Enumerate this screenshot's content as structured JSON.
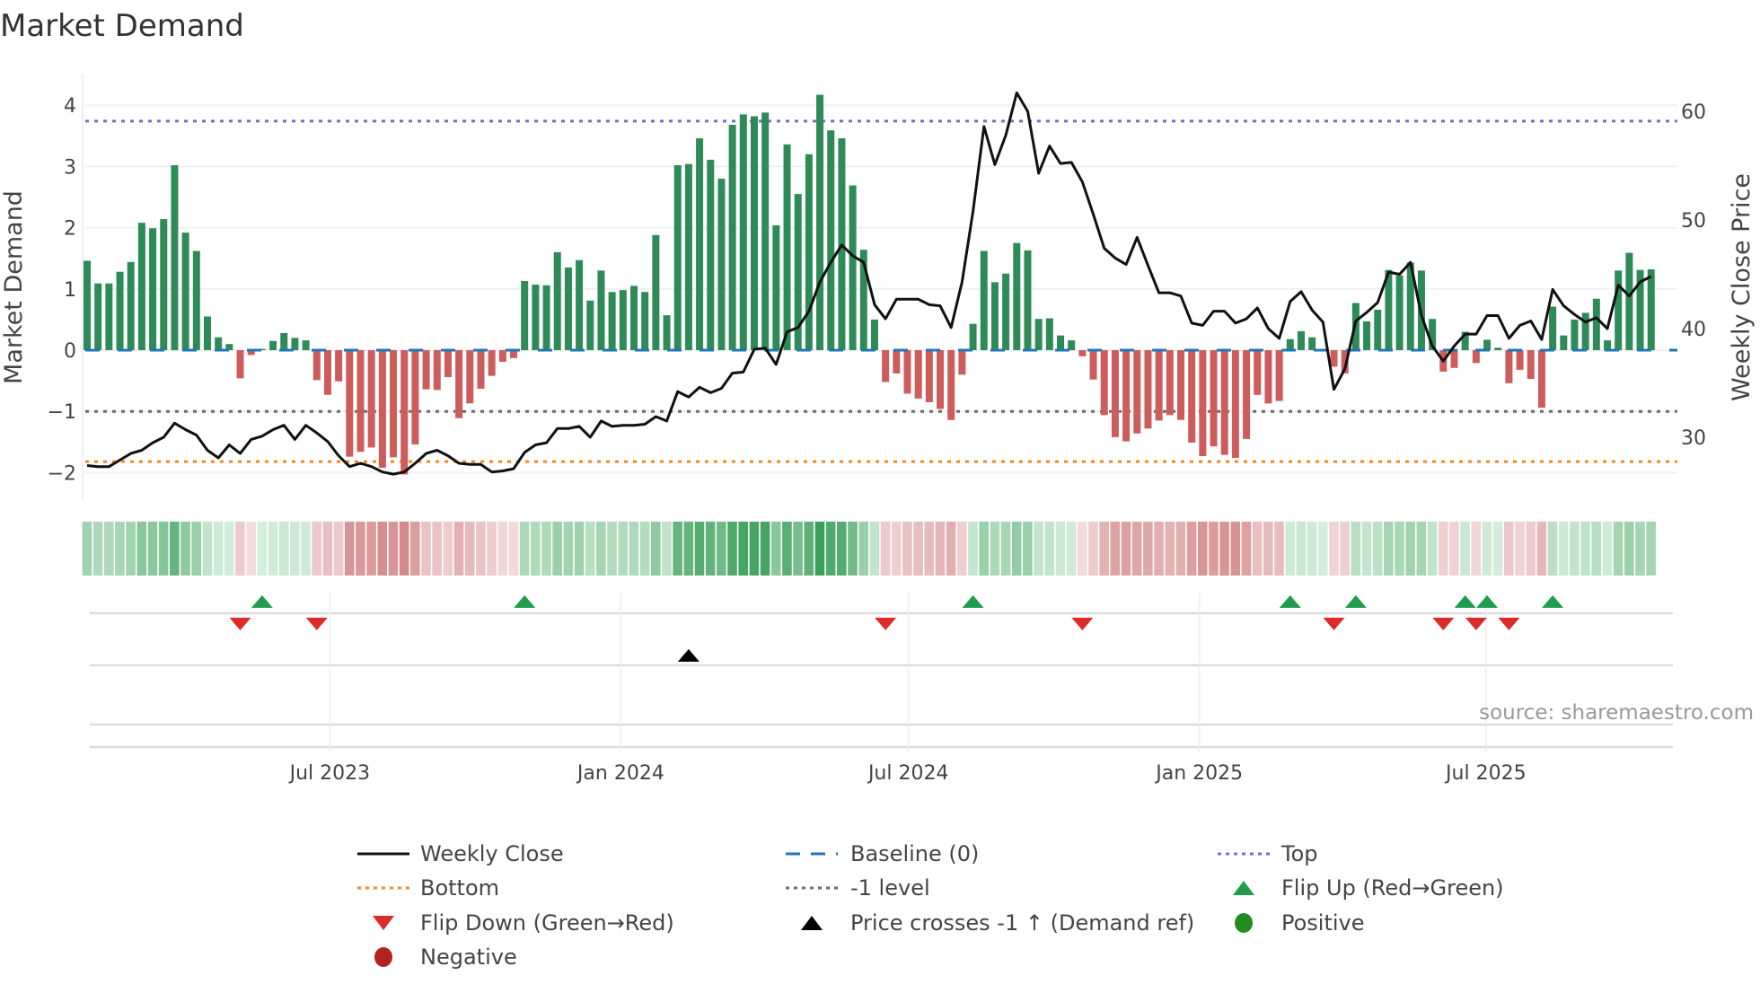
{
  "title": "Market Demand",
  "source": "source: sharemaestro.com",
  "colors": {
    "bar_positive": "#2e8b57",
    "bar_negative": "#cd5c5c",
    "price_line": "#111111",
    "baseline": "#1f77b4",
    "top": "#7b68d8",
    "bottom": "#ee8a1f",
    "minus_one": "#6b6b6b",
    "flip_up": "#1f9d4c",
    "flip_down": "#dd2a2a",
    "price_cross": "#000000",
    "positive": "#228b22",
    "negative": "#b22222"
  },
  "chart_data": {
    "type": "bar+line",
    "title": "Market Demand",
    "ylabel": "Market Demand",
    "y2label": "Weekly Close Price",
    "ylim": [
      -2.2,
      4.4
    ],
    "y2lim": [
      26.0,
      63.8
    ],
    "yticks": [
      -2,
      -1,
      0,
      1,
      2,
      3,
      4
    ],
    "ytick_labels": [
      "−2",
      "−1",
      "0",
      "1",
      "2",
      "3",
      "4"
    ],
    "y2ticks": [
      30,
      40,
      50,
      60
    ],
    "y2tick_labels": [
      "30",
      "40",
      "50",
      "60"
    ],
    "x_ticks": [
      {
        "label": "Jul 2023",
        "week": 22.2
      },
      {
        "label": "Jan 2024",
        "week": 48.8
      },
      {
        "label": "Jul 2024",
        "week": 75.1
      },
      {
        "label": "Jan 2025",
        "week": 101.7
      },
      {
        "label": "Jul 2025",
        "week": 127.9
      }
    ],
    "reference_lines": {
      "top": 3.74,
      "bottom": -1.82,
      "minus_one": -1,
      "baseline": 0
    },
    "demand": [
      1.46,
      1.09,
      1.09,
      1.28,
      1.44,
      2.08,
      1.99,
      2.14,
      3.02,
      1.92,
      1.62,
      0.55,
      0.21,
      0.1,
      -0.46,
      -0.08,
      0.02,
      0.15,
      0.28,
      0.2,
      0.16,
      -0.49,
      -0.73,
      -0.51,
      -1.74,
      -1.66,
      -1.59,
      -1.92,
      -1.75,
      -2.03,
      -1.54,
      -0.64,
      -0.65,
      -0.44,
      -1.11,
      -0.87,
      -0.63,
      -0.42,
      -0.19,
      -0.13,
      1.13,
      1.07,
      1.06,
      1.6,
      1.35,
      1.47,
      0.81,
      1.3,
      0.95,
      0.98,
      1.05,
      0.95,
      1.88,
      0.57,
      3.02,
      3.04,
      3.46,
      3.11,
      2.8,
      3.68,
      3.85,
      3.82,
      3.88,
      2.04,
      3.36,
      2.55,
      3.2,
      4.17,
      3.59,
      3.46,
      2.69,
      1.64,
      0.5,
      -0.52,
      -0.38,
      -0.71,
      -0.79,
      -0.85,
      -0.96,
      -1.14,
      -0.4,
      0.43,
      1.62,
      1.11,
      1.25,
      1.75,
      1.63,
      0.51,
      0.52,
      0.24,
      0.16,
      -0.1,
      -0.48,
      -1.06,
      -1.42,
      -1.49,
      -1.36,
      -1.28,
      -1.15,
      -1.06,
      -1.14,
      -1.51,
      -1.73,
      -1.57,
      -1.71,
      -1.76,
      -1.45,
      -0.73,
      -0.87,
      -0.83,
      0.18,
      0.31,
      0.21,
      0.0,
      -0.27,
      -0.38,
      0.77,
      0.47,
      0.66,
      1.31,
      1.22,
      1.43,
      1.3,
      0.51,
      -0.35,
      -0.29,
      0.3,
      -0.21,
      0.17,
      0.04,
      -0.54,
      -0.32,
      -0.47,
      -0.94,
      0.71,
      0.24,
      0.5,
      0.61,
      0.84,
      0.16,
      1.3,
      1.59,
      1.31,
      1.32
    ],
    "weekly_close": [
      27.4,
      27.3,
      27.3,
      27.9,
      28.5,
      28.8,
      29.5,
      30.0,
      31.3,
      30.7,
      30.2,
      28.8,
      28.1,
      29.3,
      28.5,
      29.8,
      30.1,
      30.7,
      31.1,
      29.8,
      31.1,
      30.4,
      29.6,
      28.3,
      27.3,
      27.6,
      27.3,
      26.8,
      26.6,
      26.8,
      27.6,
      28.5,
      28.8,
      28.3,
      27.6,
      27.5,
      27.5,
      26.8,
      26.9,
      27.1,
      28.6,
      29.3,
      29.5,
      30.8,
      30.8,
      31.0,
      30.0,
      31.5,
      31.0,
      31.1,
      31.1,
      31.2,
      31.9,
      31.5,
      34.2,
      33.7,
      34.6,
      34.1,
      34.5,
      35.9,
      36.0,
      38.1,
      38.2,
      36.7,
      39.7,
      40.1,
      41.6,
      44.3,
      46.1,
      47.7,
      46.7,
      46.1,
      42.2,
      40.9,
      42.7,
      42.7,
      42.7,
      42.2,
      42.1,
      40.1,
      44.3,
      50.8,
      58.6,
      55.1,
      57.8,
      61.7,
      60.0,
      54.3,
      56.8,
      55.2,
      55.3,
      53.5,
      50.5,
      47.4,
      46.5,
      45.9,
      48.4,
      45.8,
      43.3,
      43.3,
      43.0,
      40.5,
      40.3,
      41.6,
      41.6,
      40.5,
      40.9,
      41.9,
      40.0,
      39.1,
      42.5,
      43.4,
      41.7,
      40.6,
      34.4,
      36.3,
      40.7,
      41.5,
      42.4,
      45.2,
      45.0,
      46.1,
      41.2,
      38.4,
      37.0,
      38.4,
      39.5,
      39.5,
      41.2,
      41.2,
      39.1,
      40.3,
      40.7,
      39.0,
      43.6,
      42.1,
      41.3,
      40.6,
      41.0,
      40.0,
      44.0,
      43.0,
      44.3,
      44.8
    ],
    "flip_up_weeks": [
      16,
      40,
      81,
      110,
      116,
      126,
      128,
      134
    ],
    "flip_down_weeks": [
      14,
      21,
      73,
      91,
      114,
      124,
      127,
      130
    ],
    "price_cross_weeks": [
      55
    ],
    "legend": [
      {
        "label": "Weekly Close",
        "symbol": "solid-line",
        "color_key": "price_line"
      },
      {
        "label": "Baseline (0)",
        "symbol": "dashed-line",
        "color_key": "baseline"
      },
      {
        "label": "Top",
        "symbol": "dotted-line",
        "color_key": "top"
      },
      {
        "label": "Bottom",
        "symbol": "dotted-line",
        "color_key": "bottom"
      },
      {
        "label": "-1 level",
        "symbol": "dotted-line",
        "color_key": "minus_one"
      },
      {
        "label": "Flip Up (Red→Green)",
        "symbol": "triangle-up",
        "color_key": "flip_up"
      },
      {
        "label": "Flip Down (Green→Red)",
        "symbol": "triangle-down",
        "color_key": "flip_down"
      },
      {
        "label": "Price crosses -1 ↑ (Demand ref)",
        "symbol": "triangle-up",
        "color_key": "price_cross"
      },
      {
        "label": "Positive",
        "symbol": "circle",
        "color_key": "positive"
      },
      {
        "label": "Negative",
        "symbol": "circle",
        "color_key": "negative"
      }
    ],
    "legend_placement": "bottom"
  }
}
